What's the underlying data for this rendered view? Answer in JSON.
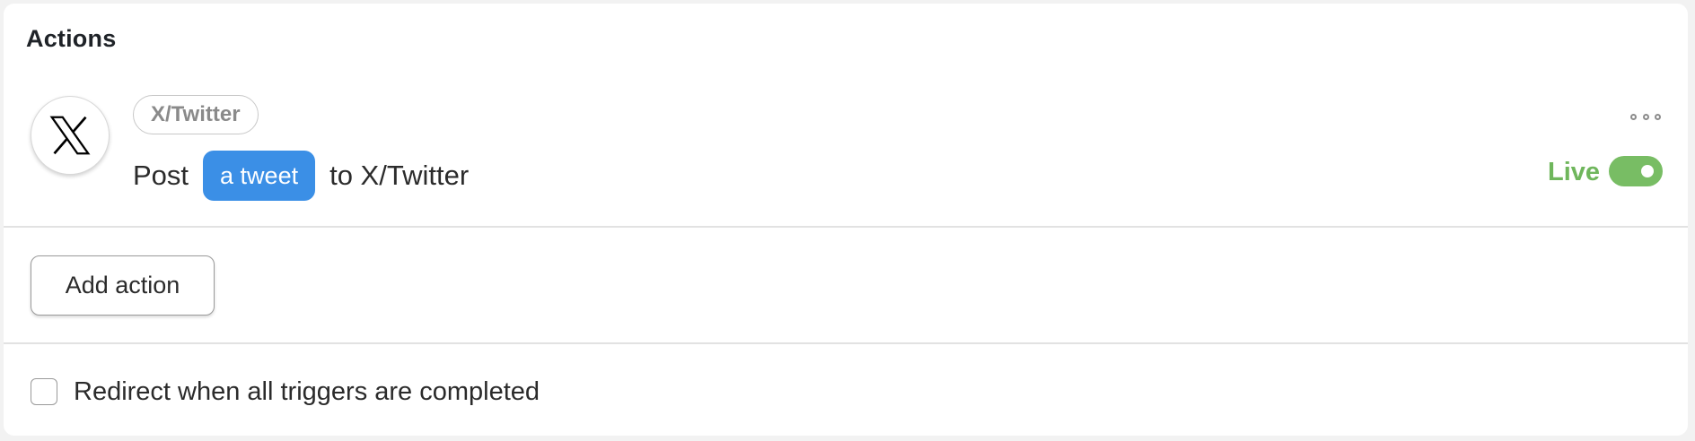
{
  "section": {
    "title": "Actions"
  },
  "action": {
    "icon": "x-twitter-logo-icon",
    "service_tag": "X/Twitter",
    "verb": "Post",
    "object_pill": "a tweet",
    "target": "to X/Twitter",
    "status_label": "Live",
    "status_enabled": true,
    "menu_icon": "more-options-icon"
  },
  "add_action": {
    "label": "Add action"
  },
  "redirect": {
    "label": "Redirect when all triggers are completed",
    "checked": false
  },
  "colors": {
    "accent_blue": "#3b8fe6",
    "live_green": "#6fb65c",
    "toggle_green": "#78bd64"
  }
}
